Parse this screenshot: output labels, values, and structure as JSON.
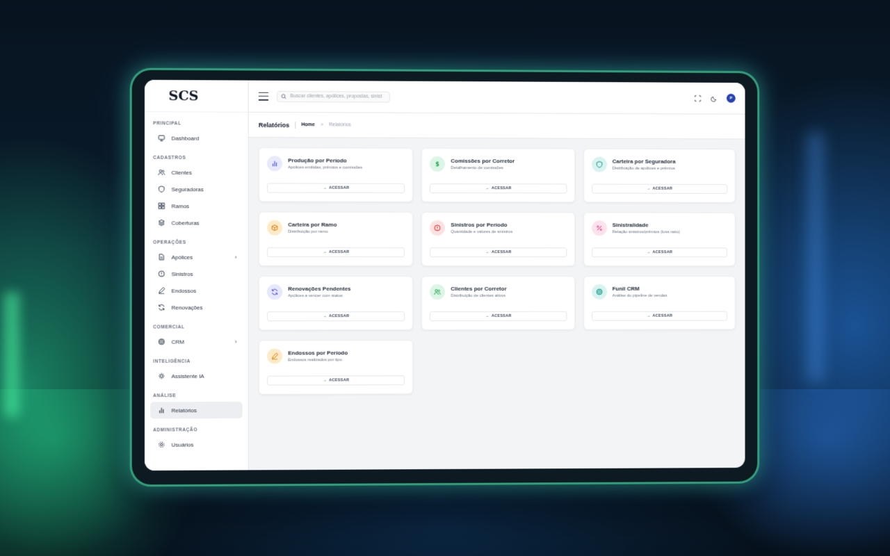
{
  "brand": {
    "logo": "SCS"
  },
  "sidebar": {
    "sections": [
      {
        "title": "PRINCIPAL",
        "items": [
          {
            "label": "Dashboard",
            "icon": "monitor-icon"
          }
        ]
      },
      {
        "title": "CADASTROS",
        "items": [
          {
            "label": "Clientes",
            "icon": "users-icon"
          },
          {
            "label": "Seguradoras",
            "icon": "shield-icon"
          },
          {
            "label": "Ramos",
            "icon": "grid-icon"
          },
          {
            "label": "Coberturas",
            "icon": "layers-icon"
          }
        ]
      },
      {
        "title": "OPERAÇÕES",
        "items": [
          {
            "label": "Apólices",
            "icon": "file-icon",
            "has_children": true
          },
          {
            "label": "Sinistros",
            "icon": "alert-circle-icon"
          },
          {
            "label": "Endossos",
            "icon": "pen-icon"
          },
          {
            "label": "Renovações",
            "icon": "refresh-icon"
          }
        ]
      },
      {
        "title": "COMERCIAL",
        "items": [
          {
            "label": "CRM",
            "icon": "target-icon",
            "has_children": true
          }
        ]
      },
      {
        "title": "INTELIGÊNCIA",
        "items": [
          {
            "label": "Assistente IA",
            "icon": "cpu-icon"
          }
        ]
      },
      {
        "title": "ANÁLISE",
        "items": [
          {
            "label": "Relatórios",
            "icon": "bar-chart-icon",
            "active": true
          }
        ]
      },
      {
        "title": "ADMINISTRAÇÃO",
        "items": [
          {
            "label": "Usuários",
            "icon": "gear-icon"
          }
        ]
      }
    ]
  },
  "topbar": {
    "search_placeholder": "Buscar clientes, apólices, propostas, sinist",
    "avatar_initial": "P"
  },
  "breadcrumb": {
    "title": "Relatórios",
    "home": "Home",
    "separator": ">",
    "current": "Relatórios"
  },
  "reports": [
    {
      "title": "Produção por Período",
      "desc": "Apólices emitidas, prêmios e comissões",
      "button": "ACESSAR",
      "icon": "bar-chart-icon",
      "color": "#4f5bd5",
      "bg": "#e8eafc"
    },
    {
      "title": "Comissões por Corretor",
      "desc": "Detalhamento de comissões",
      "button": "ACESSAR",
      "icon": "dollar-icon",
      "color": "#16a34a",
      "bg": "#dcf5e6"
    },
    {
      "title": "Carteira por Seguradora",
      "desc": "Distribuição de apólices e prêmios",
      "button": "ACESSAR",
      "icon": "shield-icon",
      "color": "#0d9488",
      "bg": "#d9f3f0"
    },
    {
      "title": "Carteira por Ramo",
      "desc": "Distribuição por ramo",
      "button": "ACESSAR",
      "icon": "box-icon",
      "color": "#d97706",
      "bg": "#fdebc8"
    },
    {
      "title": "Sinistros por Período",
      "desc": "Quantidade e valores de sinistros",
      "button": "ACESSAR",
      "icon": "alert-circle-icon",
      "color": "#dc2626",
      "bg": "#fde2e2"
    },
    {
      "title": "Sinistralidade",
      "desc": "Relação sinistros/prêmios (loss ratio)",
      "button": "ACESSAR",
      "icon": "percent-icon",
      "color": "#db2777",
      "bg": "#fde2ec"
    },
    {
      "title": "Renovações Pendentes",
      "desc": "Apólices a vencer com status",
      "button": "ACESSAR",
      "icon": "refresh-icon",
      "color": "#4f46e5",
      "bg": "#e6e8fb"
    },
    {
      "title": "Clientes por Corretor",
      "desc": "Distribuição de clientes ativos",
      "button": "ACESSAR",
      "icon": "users-icon",
      "color": "#16a34a",
      "bg": "#dcf5e6"
    },
    {
      "title": "Funil CRM",
      "desc": "Análise do pipeline de vendas",
      "button": "ACESSAR",
      "icon": "target-icon",
      "color": "#0d9488",
      "bg": "#d9f3f0"
    },
    {
      "title": "Endossos por Período",
      "desc": "Endossos realizados por tipo",
      "button": "ACESSAR",
      "icon": "pen-icon",
      "color": "#d97706",
      "bg": "#fdebc8"
    }
  ]
}
